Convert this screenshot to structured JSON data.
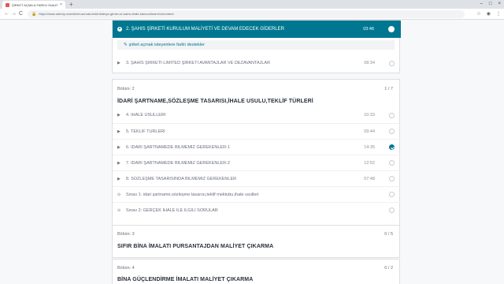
{
  "browser": {
    "tab_title": "ŞİRKET AÇMA & FARKLI İHALEY...",
    "tab_close": "×",
    "new_tab": "+",
    "url": "https://www.udemy.com/sirket-acmak-farkli-ihaleye-girme-ve-kamu-ihale-kanunu/learn/v4/content",
    "nav_back": "←",
    "nav_forward": "→",
    "nav_reload": "C",
    "window_controls": [
      "–",
      "□",
      "×"
    ]
  },
  "section1": {
    "active_lecture": {
      "title": "2. ŞAHIS ŞİRKETİ KURULUM MALİYETİ VE DEVAM EDECEK GİDERLER",
      "duration": "03:46"
    },
    "resource": {
      "label": "şirket açmak isteyenlere farklı destekler"
    },
    "lectures": [
      {
        "title": "3. ŞAHIS ŞİRKETİ-LİMİTED ŞİRKETİ AVANTAJLAR VE DEZAVANTAJLAR",
        "duration": "08:34",
        "completed": false
      }
    ]
  },
  "section2": {
    "label": "Bölüm: 2",
    "count": "1 / 7",
    "title": "İDARİ ŞARTNAME,SÖZLEŞME TASARISI,İHALE USULU,TEKLİF TÜRLERİ",
    "lectures": [
      {
        "title": "4. İHALE USULLERİ",
        "duration": "10:33",
        "completed": false,
        "kind": "video"
      },
      {
        "title": "5. TEKLİF TÜRLERİ",
        "duration": "09:44",
        "completed": false,
        "kind": "video"
      },
      {
        "title": "6. İDARİ ŞARTNAMEDE BİLMEMİZ GEREKENLER-1",
        "duration": "14:35",
        "completed": true,
        "kind": "video"
      },
      {
        "title": "7. İDARİ ŞARTNAMEDE BİLMEMİZ GEREKENLER-2",
        "duration": "12:52",
        "completed": false,
        "kind": "video"
      },
      {
        "title": "8. SÖZLEŞME TASARISINDA BİLMEMİZ GEREKENLER",
        "duration": "07:48",
        "completed": false,
        "kind": "video"
      },
      {
        "title": "Sınav 1: idari şartname,sözleşme tasarısı,teklif mektubu,ihale usulleri",
        "duration": "",
        "completed": false,
        "kind": "quiz"
      },
      {
        "title": "Sınav 2: GERÇEK İHALE İLE İLGİLİ SORULAR",
        "duration": "",
        "completed": false,
        "kind": "quiz"
      }
    ]
  },
  "section3": {
    "label": "Bölüm: 3",
    "count": "0 / 5",
    "title": "SIFIR BİNA İMALATI PURSANTAJDAN MALİYET ÇIKARMA"
  },
  "section4": {
    "label": "Bölüm: 4",
    "count": "0 / 2",
    "title": "BİNA GÜÇLENDİRME İMALATI MALİYET ÇIKARMA"
  },
  "icons": {
    "play": "▶",
    "quiz": "⊙",
    "resource": "✎"
  },
  "colors": {
    "accent": "#007791",
    "background": "#f7f8fa",
    "text": "#29303b",
    "muted": "#686f7a"
  }
}
